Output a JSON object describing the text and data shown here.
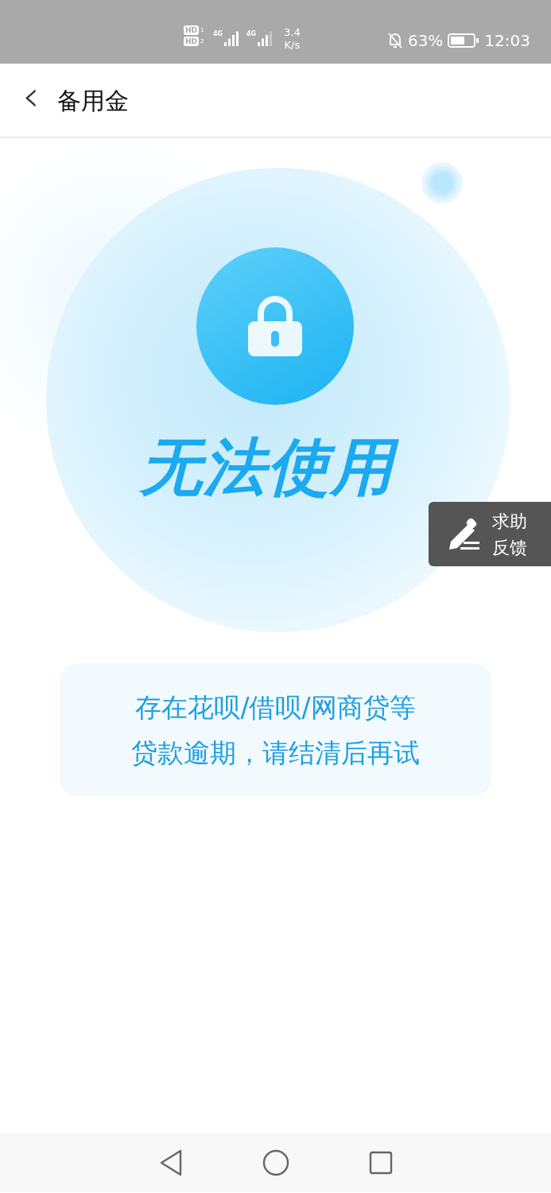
{
  "status_bar": {
    "sims": [
      {
        "label": "HD",
        "slot": "1"
      },
      {
        "label": "HD",
        "slot": "2"
      }
    ],
    "networks": [
      "4G",
      "4G"
    ],
    "speed": {
      "value": "3.4",
      "unit": "K/s"
    },
    "battery": "63%",
    "time": "12:03"
  },
  "header": {
    "back": "‹",
    "title": "备用金"
  },
  "hero": {
    "title": "无法使用"
  },
  "feedback": {
    "lines": [
      "求助",
      "反馈"
    ]
  },
  "message": {
    "lines": [
      "存在花呗/借呗/网商贷等",
      "贷款逾期，请结清后再试"
    ]
  }
}
